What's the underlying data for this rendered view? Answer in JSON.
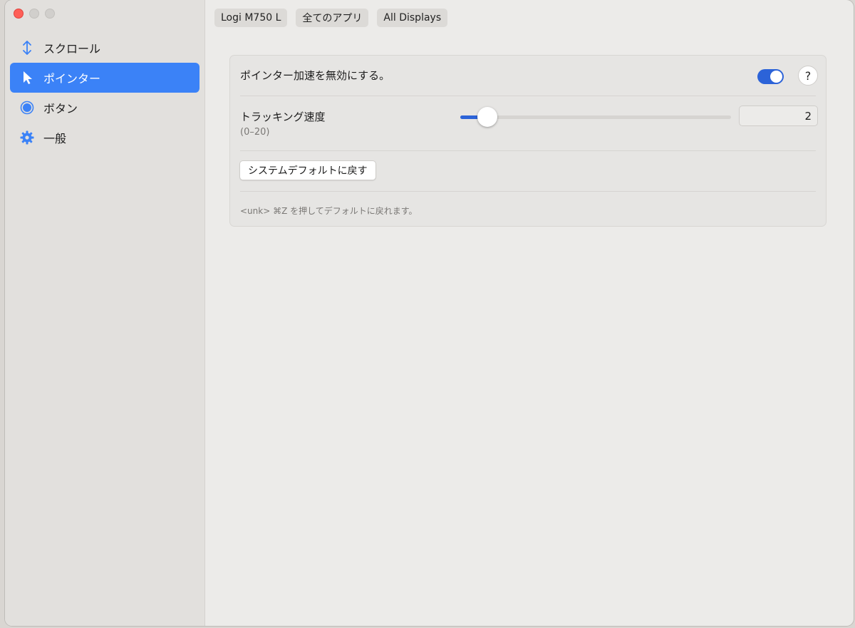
{
  "window": {
    "controls": [
      "close",
      "minimize",
      "maximize"
    ]
  },
  "sidebar": {
    "items": [
      {
        "label": "スクロール",
        "icon": "scroll-arrows-icon",
        "active": false
      },
      {
        "label": "ポインター",
        "icon": "pointer-arrow-icon",
        "active": true
      },
      {
        "label": "ボタン",
        "icon": "button-circle-icon",
        "active": false
      },
      {
        "label": "一般",
        "icon": "gear-icon",
        "active": false
      }
    ]
  },
  "toolbar": {
    "device": "Logi M750 L",
    "apps": "全てのアプリ",
    "displays": "All Displays"
  },
  "settings": {
    "disable_accel_label": "ポインター加速を無効にする。",
    "disable_accel_on": true,
    "help_label": "?",
    "tracking_label": "トラッキング速度",
    "tracking_range": "(0–20)",
    "tracking_value": "2",
    "tracking_fraction": 0.1,
    "reset_label": "システムデフォルトに戻す",
    "hint": "<unk> ⌘Z を押してデフォルトに戻れます。"
  },
  "colors": {
    "accent": "#3b82f7",
    "toggle_on": "#2c63d8",
    "close": "#fe5f57"
  }
}
